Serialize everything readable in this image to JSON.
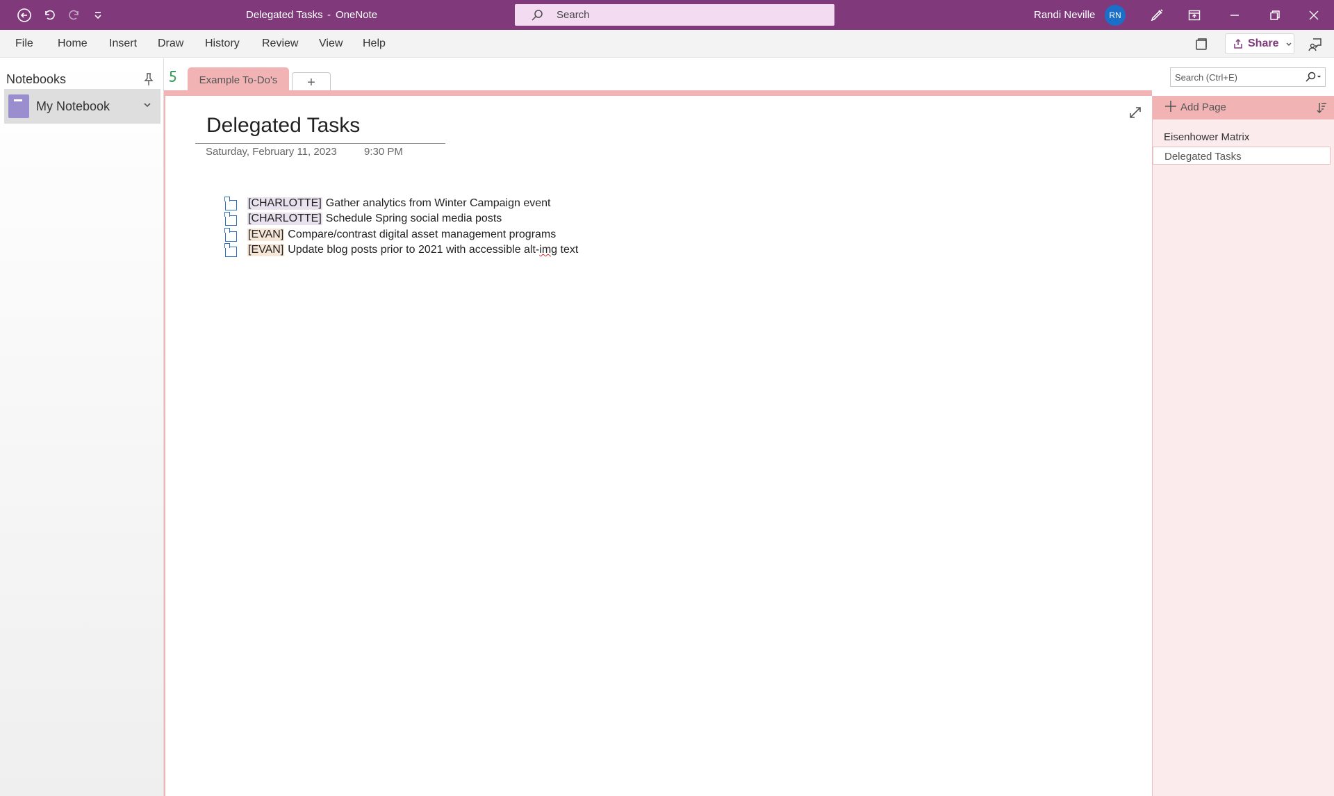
{
  "titlebar": {
    "document_title": "Delegated Tasks",
    "separator": "-",
    "app_name": "OneNote",
    "search_placeholder": "Search",
    "user_name": "Randi Neville",
    "user_initials": "RN"
  },
  "menu": {
    "items": [
      "File",
      "Home",
      "Insert",
      "Draw",
      "History",
      "Review",
      "View",
      "Help"
    ],
    "share_label": "Share"
  },
  "nav": {
    "header": "Notebooks",
    "notebook_name": "My Notebook"
  },
  "sections": {
    "active_tab": "Example To-Do's",
    "add_tab_label": "+",
    "search_placeholder": "Search (Ctrl+E)"
  },
  "page": {
    "title": "Delegated Tasks",
    "date": "Saturday, February 11, 2023",
    "time": "9:30 PM",
    "tasks": [
      {
        "tag": "[CHARLOTTE]",
        "text": "Gather analytics from Winter Campaign event"
      },
      {
        "tag": "[CHARLOTTE]",
        "text": "Schedule Spring social media posts"
      },
      {
        "tag": "[EVAN]",
        "text": "Compare/contrast digital asset management programs"
      },
      {
        "tag": "[EVAN]",
        "text_before": "Update blog posts prior to 2021 with accessible alt-",
        "text_misspelled": "img",
        "text_after": " text"
      }
    ]
  },
  "pagelist": {
    "add_page_label": "Add Page",
    "pages": [
      "Eisenhower Matrix",
      "Delegated Tasks"
    ]
  },
  "colors": {
    "brand": "#80397b",
    "section_tab": "#f2b3b5",
    "avatar": "#1a6fc9",
    "checkbox": "#2a6ebd"
  }
}
